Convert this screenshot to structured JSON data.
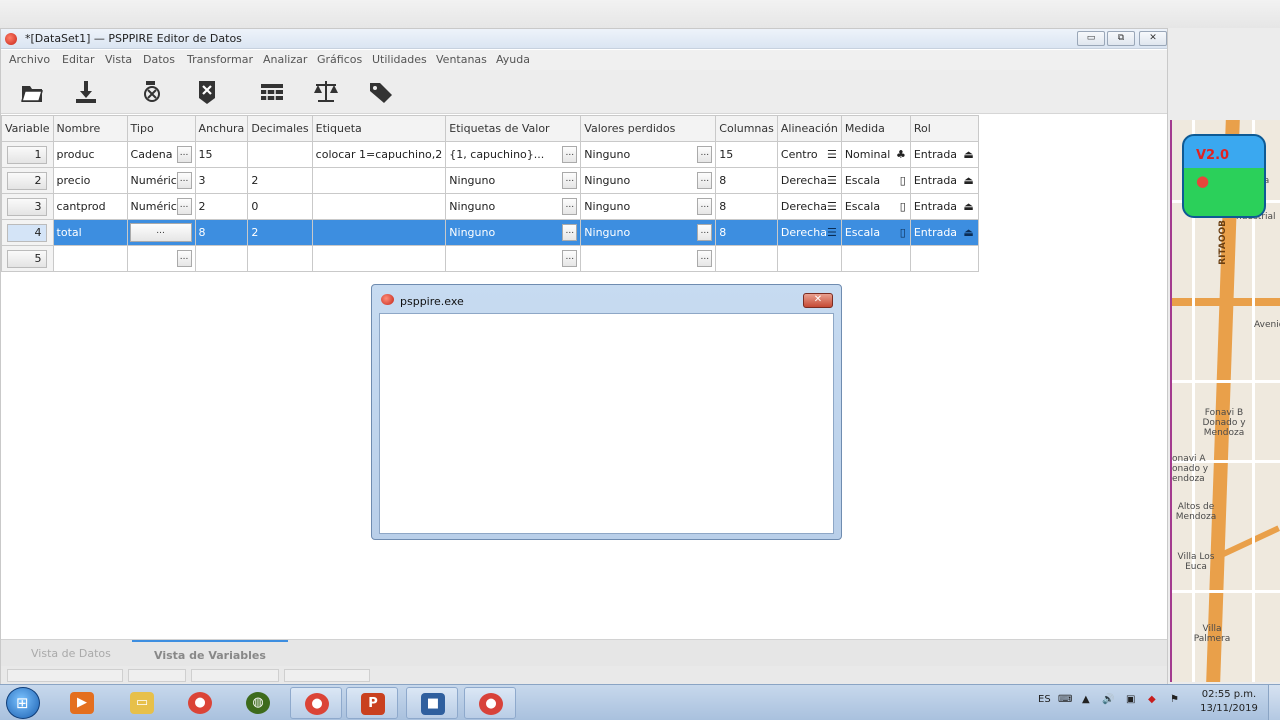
{
  "window": {
    "title": "*[DataSet1] — PSPPIRE Editor de Datos",
    "controls": {
      "minimize": "▭",
      "restore": "⧉",
      "close": "✕"
    }
  },
  "menu": [
    "Archivo",
    "Editar",
    "Vista",
    "Datos",
    "Transformar",
    "Analizar",
    "Gráficos",
    "Utilidades",
    "Ventanas",
    "Ayuda"
  ],
  "toolbar": {
    "icons": [
      "open-file-icon",
      "save-icon",
      "goto-variable-icon",
      "delete-variable-icon",
      "insert-cases-icon",
      "weight-cases-icon",
      "value-labels-icon"
    ]
  },
  "grid": {
    "columns": [
      "Variable",
      "Nombre",
      "Tipo",
      "Anchura",
      "Decimales",
      "Etiqueta",
      "Etiquetas de Valor",
      "Valores perdidos",
      "Columnas",
      "Alineación",
      "Medida",
      "Rol"
    ],
    "rows": [
      {
        "num": "1",
        "nombre": "produc",
        "tipo": "Cadena",
        "anchura": "15",
        "decimales": "",
        "etiqueta": "colocar 1=capuchino,2",
        "etiquetas_valor": "{1, capuchino}...",
        "valores_perdidos": "Ninguno",
        "columnas": "15",
        "alineacion": "Centro",
        "medida": "Nominal",
        "rol": "Entrada"
      },
      {
        "num": "2",
        "nombre": "precio",
        "tipo": "Numérico",
        "anchura": "3",
        "decimales": "2",
        "etiqueta": "",
        "etiquetas_valor": "Ninguno",
        "valores_perdidos": "Ninguno",
        "columnas": "8",
        "alineacion": "Derecha",
        "medida": "Escala",
        "rol": "Entrada"
      },
      {
        "num": "3",
        "nombre": "cantprod",
        "tipo": "Numérico",
        "anchura": "2",
        "decimales": "0",
        "etiqueta": "",
        "etiquetas_valor": "Ninguno",
        "valores_perdidos": "Ninguno",
        "columnas": "8",
        "alineacion": "Derecha",
        "medida": "Escala",
        "rol": "Entrada"
      },
      {
        "num": "4",
        "nombre": "total",
        "tipo": "...",
        "anchura": "8",
        "decimales": "2",
        "etiqueta": "",
        "etiquetas_valor": "Ninguno",
        "valores_perdidos": "Ninguno",
        "columnas": "8",
        "alineacion": "Derecha",
        "medida": "Escala",
        "rol": "Entrada"
      },
      {
        "num": "5",
        "nombre": "",
        "tipo": "",
        "anchura": "",
        "decimales": "",
        "etiqueta": "",
        "etiquetas_valor": "",
        "valores_perdidos": "",
        "columnas": "",
        "alineacion": "",
        "medida": "",
        "rol": ""
      }
    ],
    "selected_row": 4,
    "dots_label": "..."
  },
  "dialog": {
    "title": "psppire.exe",
    "close": "✕"
  },
  "tabs": [
    "Vista de Datos",
    "Vista de Variables"
  ],
  "active_tab": "Vista de Variables",
  "map": {
    "badge": "V2.0",
    "street": "RITAOOB",
    "labels": [
      "Fonavi B Donado y Mendoza",
      "onavi A onado y endoza",
      "Altos de Mendoza",
      "Villa Los Euca",
      "Villa Palmera",
      "Avenida",
      "ua",
      "ndustrial"
    ]
  },
  "taskbar": {
    "language": "ES",
    "time": "02:55 p.m.",
    "date": "13/11/2019"
  },
  "colors": {
    "selection": "#3d8ee0",
    "accent_map_border": "#a33b8e"
  }
}
